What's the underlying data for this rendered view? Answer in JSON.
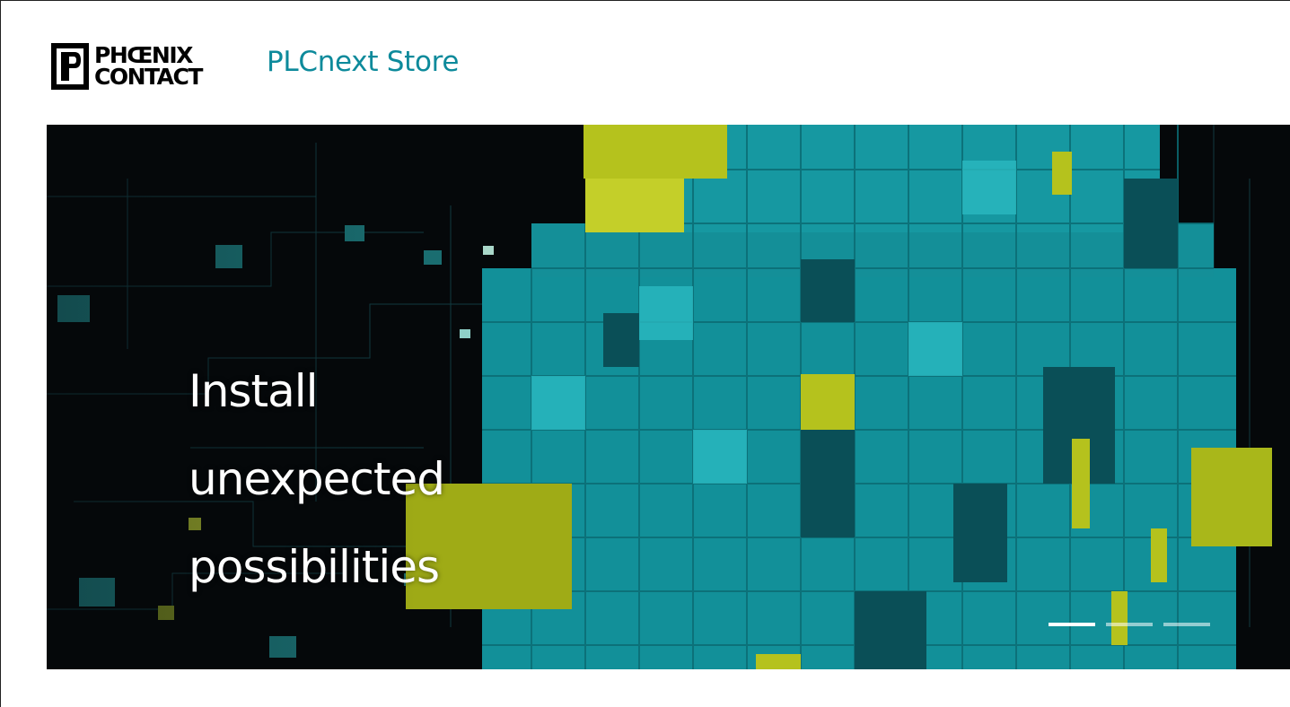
{
  "header": {
    "logo_line1": "PHŒNIX",
    "logo_line2": "CONTACT",
    "store_title": "PLCnext Store"
  },
  "hero": {
    "headline_lines": [
      "Install",
      "unexpected",
      "possibilities"
    ],
    "slides": [
      {
        "active": true
      },
      {
        "active": false
      },
      {
        "active": false
      }
    ]
  },
  "colors": {
    "brand_teal": "#0d8a9b",
    "cube_teal": "#1aa3ad",
    "cube_green": "#b9c51c",
    "hero_bg": "#05080a"
  },
  "icons": {
    "logo": "phoenix-contact-logo-icon"
  }
}
